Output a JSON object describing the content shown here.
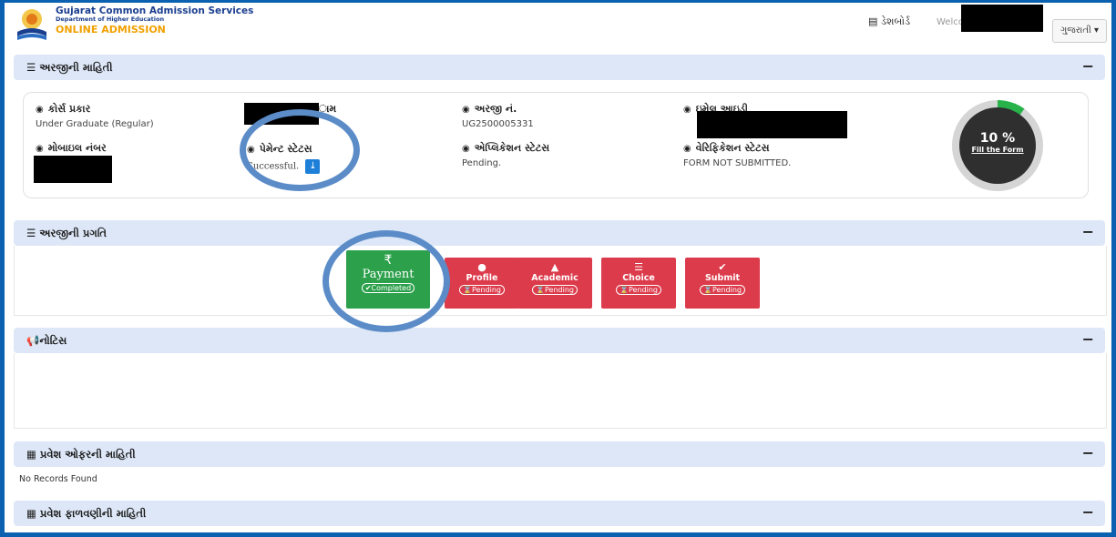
{
  "header": {
    "brand_line1": "Gujarat Common Admission Services",
    "brand_line2": "Department of Higher Education",
    "brand_line3": "ONLINE ADMISSION",
    "dashboard_label": "ડેશબોર્ડ",
    "welcome_text": "Welco",
    "language": "ગુજરાતી ▾"
  },
  "sections": {
    "application_info": "અરજીની માહિતી",
    "progress": "અરજીની પ્રગતિ",
    "notice": "નોટિસ",
    "admission_offer": "પ્રવેશ ઓફરની માહિતી",
    "admission_allotment": "પ્રવેશ ફાળવણીની માહિતી",
    "collapse_symbol": "−"
  },
  "application": {
    "course_type_label": "કોર્સ પ્રકાર",
    "course_type_value": "Under Graduate (Regular)",
    "name_label": "ામ",
    "application_no_label": "અરજી નં.",
    "application_no_value": "UG2500005331",
    "email_label": "ઇમેલ આઇડી",
    "mobile_label": "મોબાઇલ નંબર",
    "payment_status_label": "પેમેન્ટ સ્ટેટસ",
    "payment_status_value": "Successful.",
    "application_status_label": "એપ્લિકેશન સ્ટેટસ",
    "application_status_value": "Pending.",
    "verification_status_label": "વેરિફિકેશન સ્ટેટસ",
    "verification_status_value": "FORM NOT SUBMITTED.",
    "progress_percent": "10 %",
    "progress_value": 0.1,
    "fill_form_link": "Fill the Form"
  },
  "steps": [
    {
      "name": "Payment",
      "status": "Completed",
      "icon": "₹",
      "color": "#2ca04b"
    },
    {
      "name": "Profile",
      "status": "Pending",
      "icon": "👤",
      "color": "#dc3b4b"
    },
    {
      "name": "Academic",
      "status": "Pending",
      "icon": "🎓",
      "color": "#dc3b4b"
    },
    {
      "name": "Choice",
      "status": "Pending",
      "icon": "☰",
      "color": "#dc3b4b"
    },
    {
      "name": "Submit",
      "status": "Pending",
      "icon": "✔",
      "color": "#dc3b4b"
    }
  ],
  "offer": {
    "no_records": "No Records Found"
  },
  "colors": {
    "accent": "#0b61b0",
    "section_header": "#dde7f7",
    "completed": "#2ca04b",
    "pending": "#dc3b4b",
    "annotation_ring": "#5b8cc8"
  }
}
